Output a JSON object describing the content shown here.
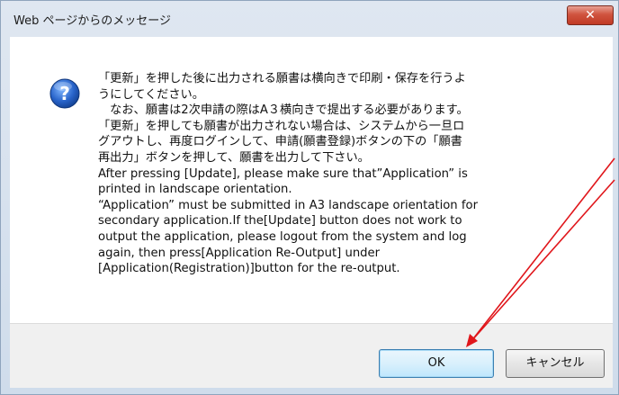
{
  "dialog": {
    "title": "Web ページからのメッセージ",
    "close_label": "✕",
    "icon": "question-icon",
    "message_lines": [
      "「更新」を押した後に出力される願書は横向きで印刷・保存を行うよ",
      "うにしてください。",
      "　なお、願書は2次申請の際はA３横向きで提出する必要があります。",
      "「更新」を押しても願書が出力されない場合は、システムから一旦ロ",
      "グアウトし、再度ログインして、申請(願書登録)ボタンの下の「願書",
      "再出力」ボタンを押して、願書を出力して下さい。",
      "After pressing [Update], please make sure that”Application” is",
      "printed in landscape orientation.",
      "“Application” must be submitted in A3 landscape orientation for",
      "secondary application.If the[Update] button does not work to",
      "output the application, please logout from the system and log",
      "again, then press[Application Re-Output] under",
      "[Application(Registration)]button for the re-output."
    ],
    "ok_label": "OK",
    "cancel_label": "キャンセル"
  },
  "colors": {
    "annotation_arrow": "#e0161b",
    "close_button": "#c8452f",
    "ok_border": "#3c7fb1"
  }
}
